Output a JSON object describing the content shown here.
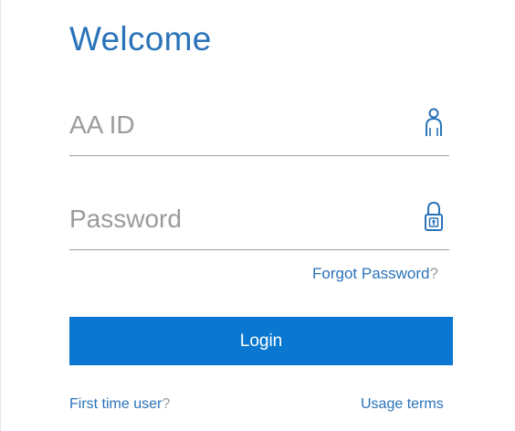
{
  "login": {
    "title": "Welcome",
    "id_placeholder": "AA ID",
    "id_value": "",
    "password_placeholder": "Password",
    "password_value": "",
    "forgot_label": "Forgot Password",
    "forgot_mark": "?",
    "login_label": "Login",
    "first_time_label": "First time user",
    "first_time_mark": "?",
    "usage_terms_label": "Usage terms"
  },
  "icons": {
    "id_field": "user-icon",
    "password_field": "lock-icon"
  },
  "colors": {
    "accent": "#2a73b9",
    "button": "#0a78d1",
    "placeholder": "#9b9b9b",
    "help_mark": "#9a9a9a"
  }
}
